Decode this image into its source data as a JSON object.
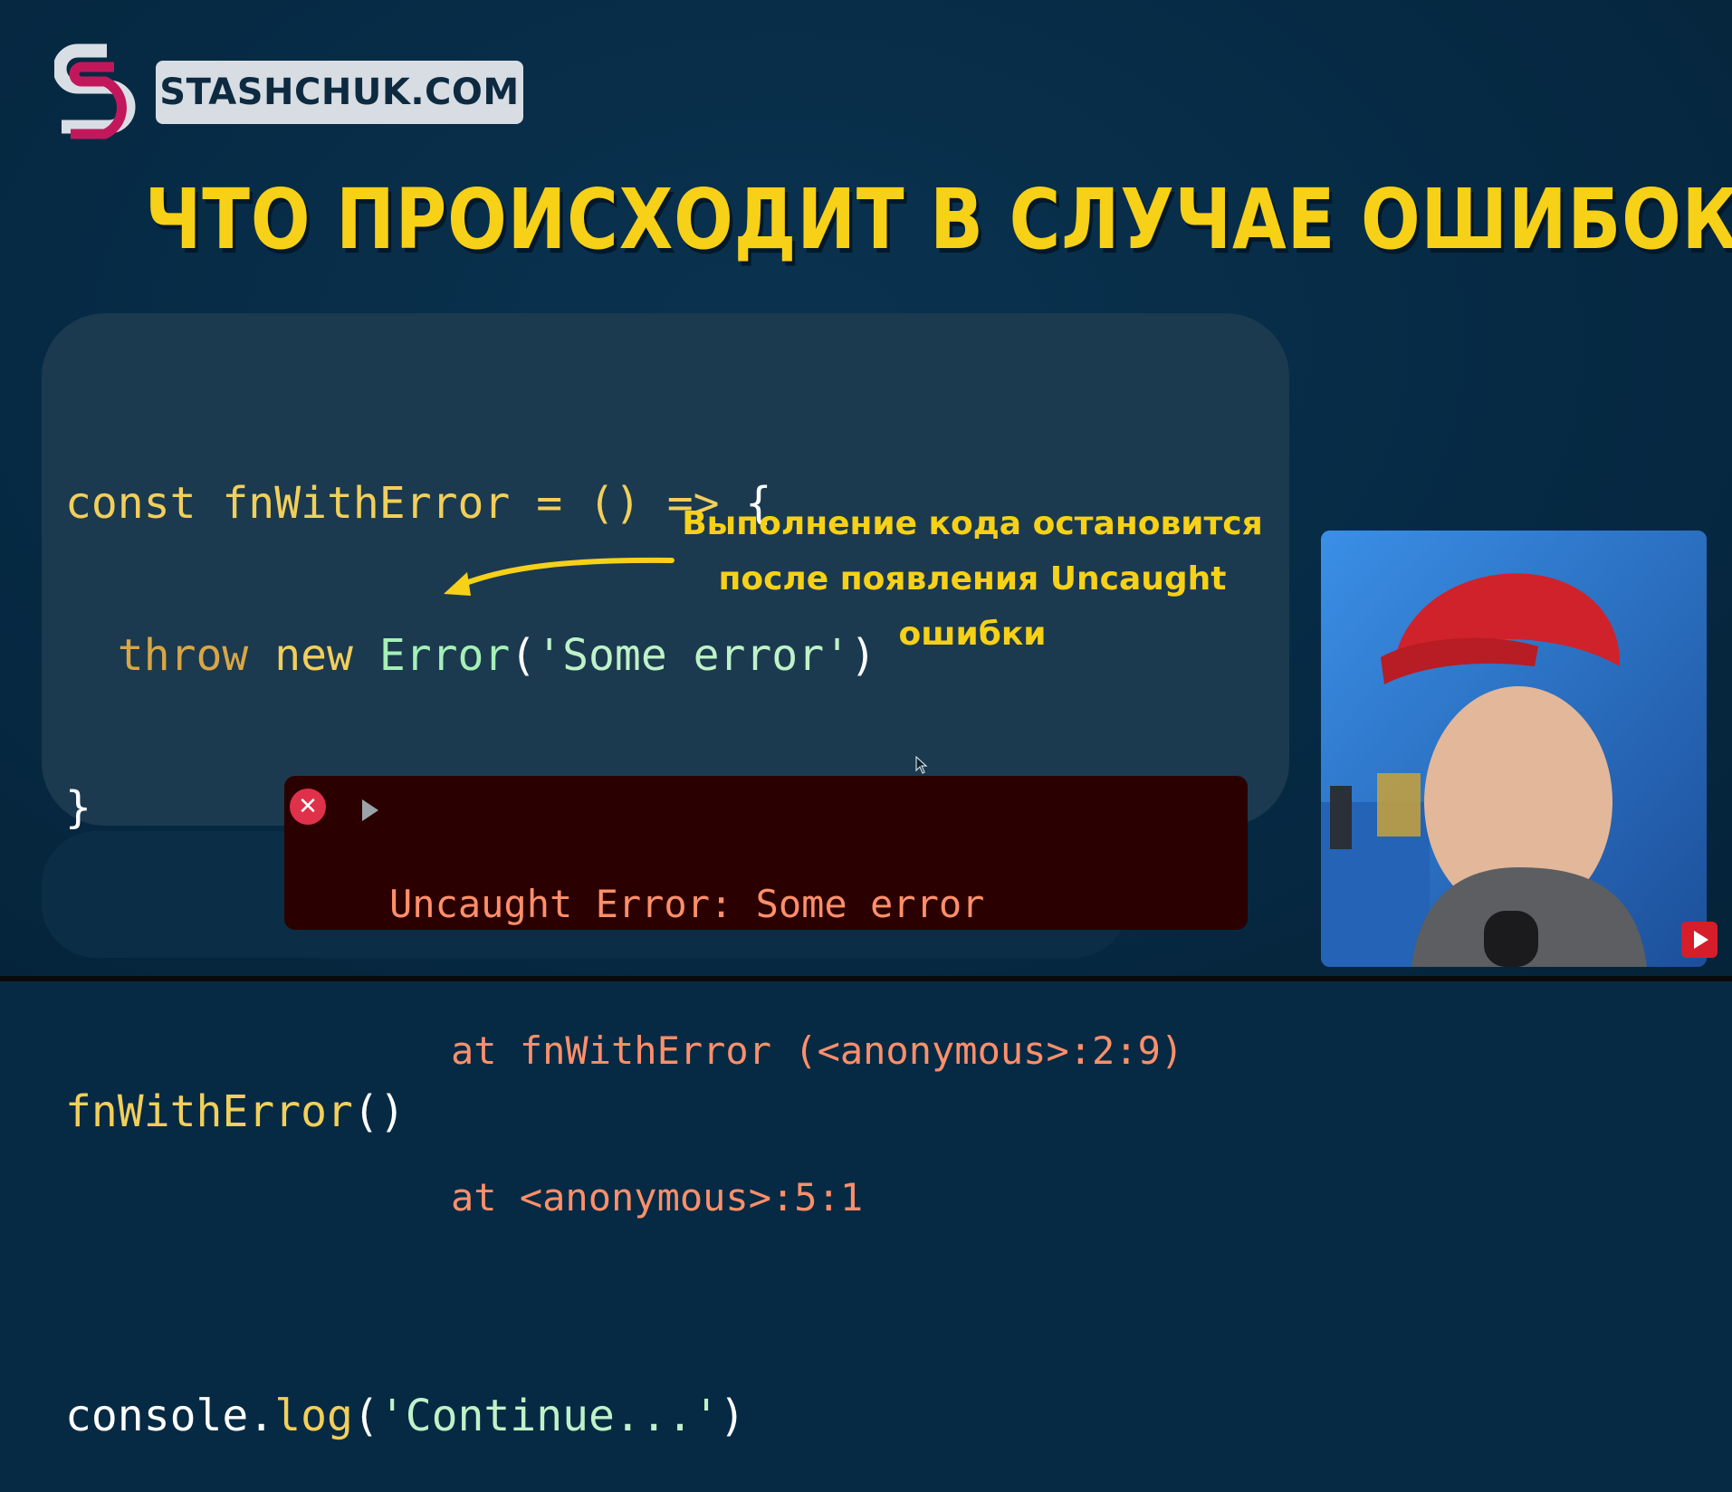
{
  "logo": {
    "icon_name": "stashchuk-s-logo",
    "site_label": "STASHCHUK.COM"
  },
  "title": "ЧТО ПРОИСХОДИТ В СЛУЧАЕ ОШИБОК",
  "code": {
    "line1": {
      "kw": "const",
      "name": "fnWithError",
      "eq": "=",
      "parens": "()",
      "arrow": "=>",
      "brace": "{"
    },
    "line2": {
      "throw": "throw",
      "new": "new",
      "cls": "Error",
      "open": "(",
      "str": "'Some error'",
      "close": ")"
    },
    "line3": {
      "brace": "}"
    },
    "line5": {
      "call": "fnWithError",
      "parens": "()"
    },
    "line7": {
      "obj": "console.",
      "method": "log",
      "open": "(",
      "str": "'Continue...'",
      "close": ")"
    }
  },
  "annotation": {
    "line1": "Выполнение кода остановится",
    "line2": "после появления Uncaught",
    "line3": "ошибки"
  },
  "console": {
    "message": "Uncaught Error: Some error",
    "trace1": "at fnWithError (<anonymous>:2:9)",
    "trace2": "at <anonymous>:5:1",
    "icon_name": "error-x-icon"
  },
  "colors": {
    "background": "#062a44",
    "title_yellow": "#f7d117",
    "code_panel": "#1b3a4f",
    "console_bg": "#2b0000",
    "console_text": "#ff8f6a",
    "error_red": "#e0314b"
  },
  "webcam": {
    "icon_name": "presenter-webcam",
    "badge_icon": "youtube-subscribe-icon"
  }
}
